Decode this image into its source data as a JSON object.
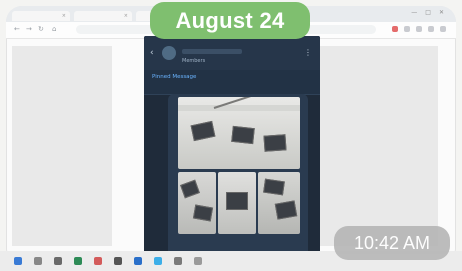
{
  "overlay": {
    "date_label": "August 24",
    "time_label": "10:42 AM"
  },
  "browser": {
    "tabs": [
      {
        "title": ""
      },
      {
        "title": ""
      },
      {
        "title": ""
      },
      {
        "title": ""
      }
    ],
    "window_controls": [
      "—",
      "□",
      "✕"
    ],
    "url": ""
  },
  "telegram": {
    "members_label": "Members",
    "pinned": {
      "title": "Pinned Message",
      "text": ""
    },
    "caption_lines": [
      "",
      ""
    ]
  },
  "colors": {
    "date_pill": "#7fbf6f",
    "time_pill": "#b7b7b7",
    "telegram_bg": "#1f2b3a",
    "pinned_title": "#6ab4ff"
  },
  "icons": {
    "back": "back-arrow-icon",
    "menu": "more-icon"
  }
}
